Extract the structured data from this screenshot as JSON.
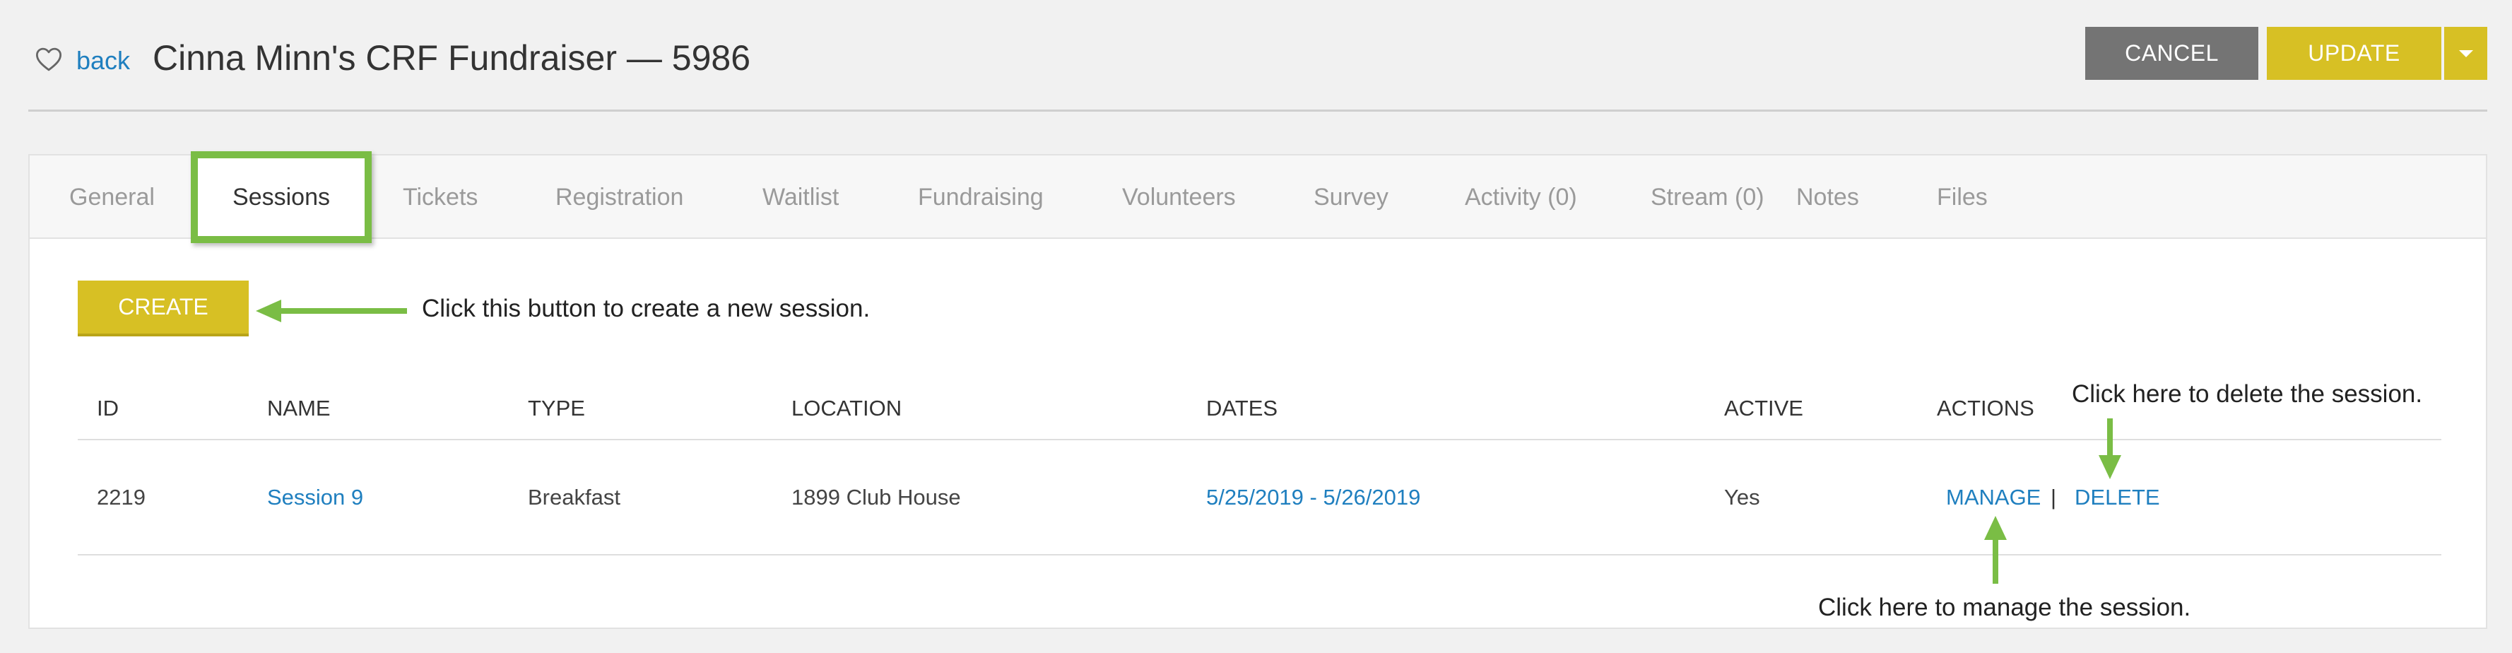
{
  "header": {
    "back_label": "back",
    "title": "Cinna Minn's CRF Fundraiser — 5986",
    "cancel_label": "CANCEL",
    "update_label": "UPDATE",
    "favorite_icon": "heart-outline-icon",
    "dropdown_icon": "caret-down-icon"
  },
  "tabs": [
    {
      "label": "General"
    },
    {
      "label": "Sessions"
    },
    {
      "label": "Tickets"
    },
    {
      "label": "Registration"
    },
    {
      "label": "Waitlist"
    },
    {
      "label": "Fundraising"
    },
    {
      "label": "Volunteers"
    },
    {
      "label": "Survey"
    },
    {
      "label": "Activity (0)"
    },
    {
      "label": "Stream (0)"
    },
    {
      "label": "Notes"
    },
    {
      "label": "Files"
    }
  ],
  "active_tab": "Sessions",
  "create_label": "CREATE",
  "annotations": {
    "create": "Click this button to create a new session.",
    "delete": "Click here to delete the session.",
    "manage": "Click here to manage the session."
  },
  "table": {
    "columns": [
      "ID",
      "NAME",
      "TYPE",
      "LOCATION",
      "DATES",
      "ACTIVE",
      "ACTIONS"
    ],
    "rows": [
      {
        "id": "2219",
        "name": "Session 9",
        "type": "Breakfast",
        "location": "1899 Club House",
        "dates": "5/25/2019 - 5/26/2019",
        "active": "Yes",
        "manage": "MANAGE",
        "separator": "|",
        "delete": "DELETE"
      }
    ]
  },
  "colors": {
    "accent_yellow": "#d7c024",
    "cancel_gray": "#747474",
    "highlight_green": "#7abd45",
    "link_blue": "#1f7fbf"
  }
}
